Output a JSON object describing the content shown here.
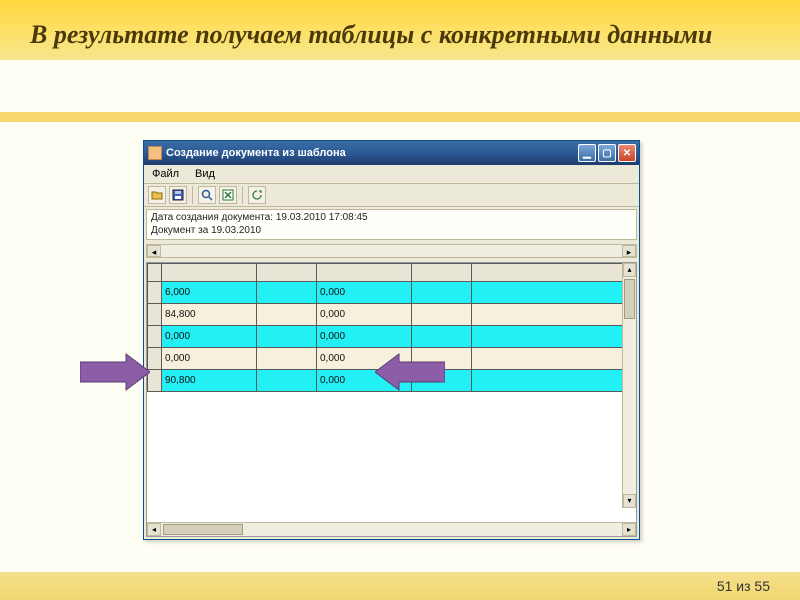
{
  "slide": {
    "title": "В результате получаем таблицы с конкретными данными",
    "footer": "51 из 55"
  },
  "window": {
    "title": "Создание документа из шаблона",
    "menu": {
      "file": "Файл",
      "view": "Вид"
    },
    "info_line1": "Дата создания документа: 19.03.2010 17:08:45",
    "info_line2": "Документ за 19.03.2010"
  },
  "icons": {
    "open": "open-icon",
    "save": "save-icon",
    "preview": "preview-icon",
    "excel": "excel-icon",
    "refresh": "refresh-icon"
  },
  "grid": {
    "rows": [
      {
        "style": "cyan",
        "c1": "6,000",
        "c2": "0,000"
      },
      {
        "style": "beige",
        "c1": "84,800",
        "c2": "0,000"
      },
      {
        "style": "cyan",
        "c1": "0,000",
        "c2": "0,000"
      },
      {
        "style": "beige",
        "c1": "0,000",
        "c2": "0,000"
      },
      {
        "style": "cyan",
        "c1": "90,800",
        "c2": "0,000"
      }
    ]
  }
}
